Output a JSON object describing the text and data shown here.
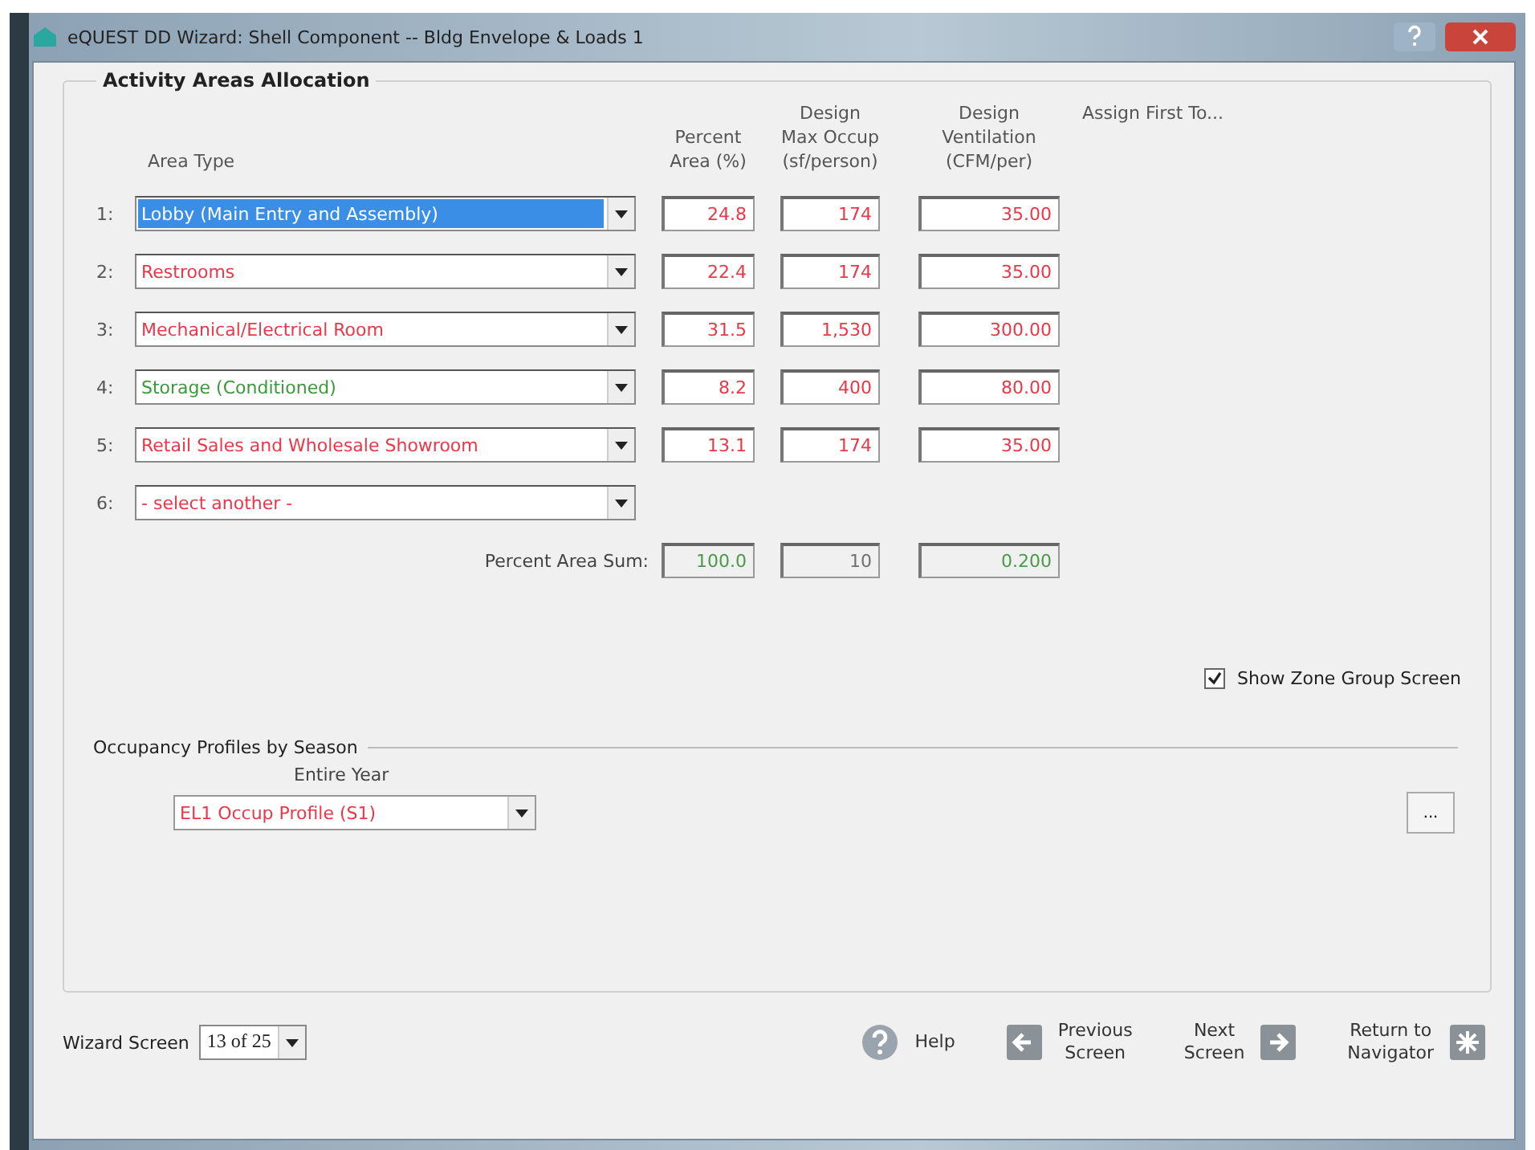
{
  "window": {
    "title": "eQUEST DD Wizard: Shell Component -- Bldg Envelope & Loads 1"
  },
  "activity_areas": {
    "title": "Activity Areas Allocation",
    "columns": [
      {
        "lines": [
          "Area Type"
        ]
      },
      {
        "lines": [
          "Percent",
          "Area (%)"
        ]
      },
      {
        "lines": [
          "Design",
          "Max Occup",
          "(sf/person)"
        ]
      },
      {
        "lines": [
          "Design",
          "Ventilation",
          "(CFM/per)"
        ]
      },
      {
        "lines": [
          "Assign First To..."
        ]
      }
    ],
    "rows": [
      {
        "index": "1:",
        "area_type": "Lobby (Main Entry and Assembly)",
        "selected": true,
        "percent_area": "24.8",
        "max_occup": "174",
        "ventilation": "35.00"
      },
      {
        "index": "2:",
        "area_type": "Restrooms",
        "color": "#e8384a",
        "selected": false,
        "percent_area": "22.4",
        "max_occup": "174",
        "ventilation": "35.00"
      },
      {
        "index": "3:",
        "area_type": "Mechanical/Electrical Room",
        "color": "#e8384a",
        "selected": false,
        "percent_area": "31.5",
        "max_occup": "1,530",
        "ventilation": "300.00"
      },
      {
        "index": "4:",
        "area_type": "Storage (Conditioned)",
        "color": "#3a9a3a",
        "selected": false,
        "percent_area": "8.2",
        "max_occup": "400",
        "ventilation": "80.00"
      },
      {
        "index": "5:",
        "area_type": "Retail Sales and Wholesale Showroom",
        "color": "#e8384a",
        "selected": false,
        "percent_area": "13.1",
        "max_occup": "174",
        "ventilation": "35.00"
      },
      {
        "index": "6:",
        "area_type": "- select another -",
        "color": "#e8384a",
        "selected": false
      }
    ],
    "sum_label": "Percent Area Sum:",
    "sums": [
      {
        "value": "100.0",
        "color": "#4a9a4a"
      },
      {
        "value": "10",
        "color": "#707070"
      },
      {
        "value": "0.200",
        "color": "#4a9a4a"
      }
    ],
    "show_zone_group": {
      "label": "Show Zone Group Screen",
      "checked": true
    }
  },
  "occupancy": {
    "title": "Occupancy Profiles by Season",
    "season_label": "Entire Year",
    "profile": "EL1 Occup Profile (S1)",
    "more_button": "..."
  },
  "footer": {
    "wizard_label": "Wizard Screen",
    "wizard_screen": "13 of 25",
    "buttons": [
      {
        "kind": "help",
        "lines": [
          "Help"
        ]
      },
      {
        "kind": "previous",
        "lines": [
          "Previous",
          "Screen"
        ]
      },
      {
        "kind": "next",
        "lines": [
          "Next",
          "Screen"
        ]
      },
      {
        "kind": "navigator",
        "lines": [
          "Return to",
          "Navigator"
        ]
      }
    ]
  }
}
